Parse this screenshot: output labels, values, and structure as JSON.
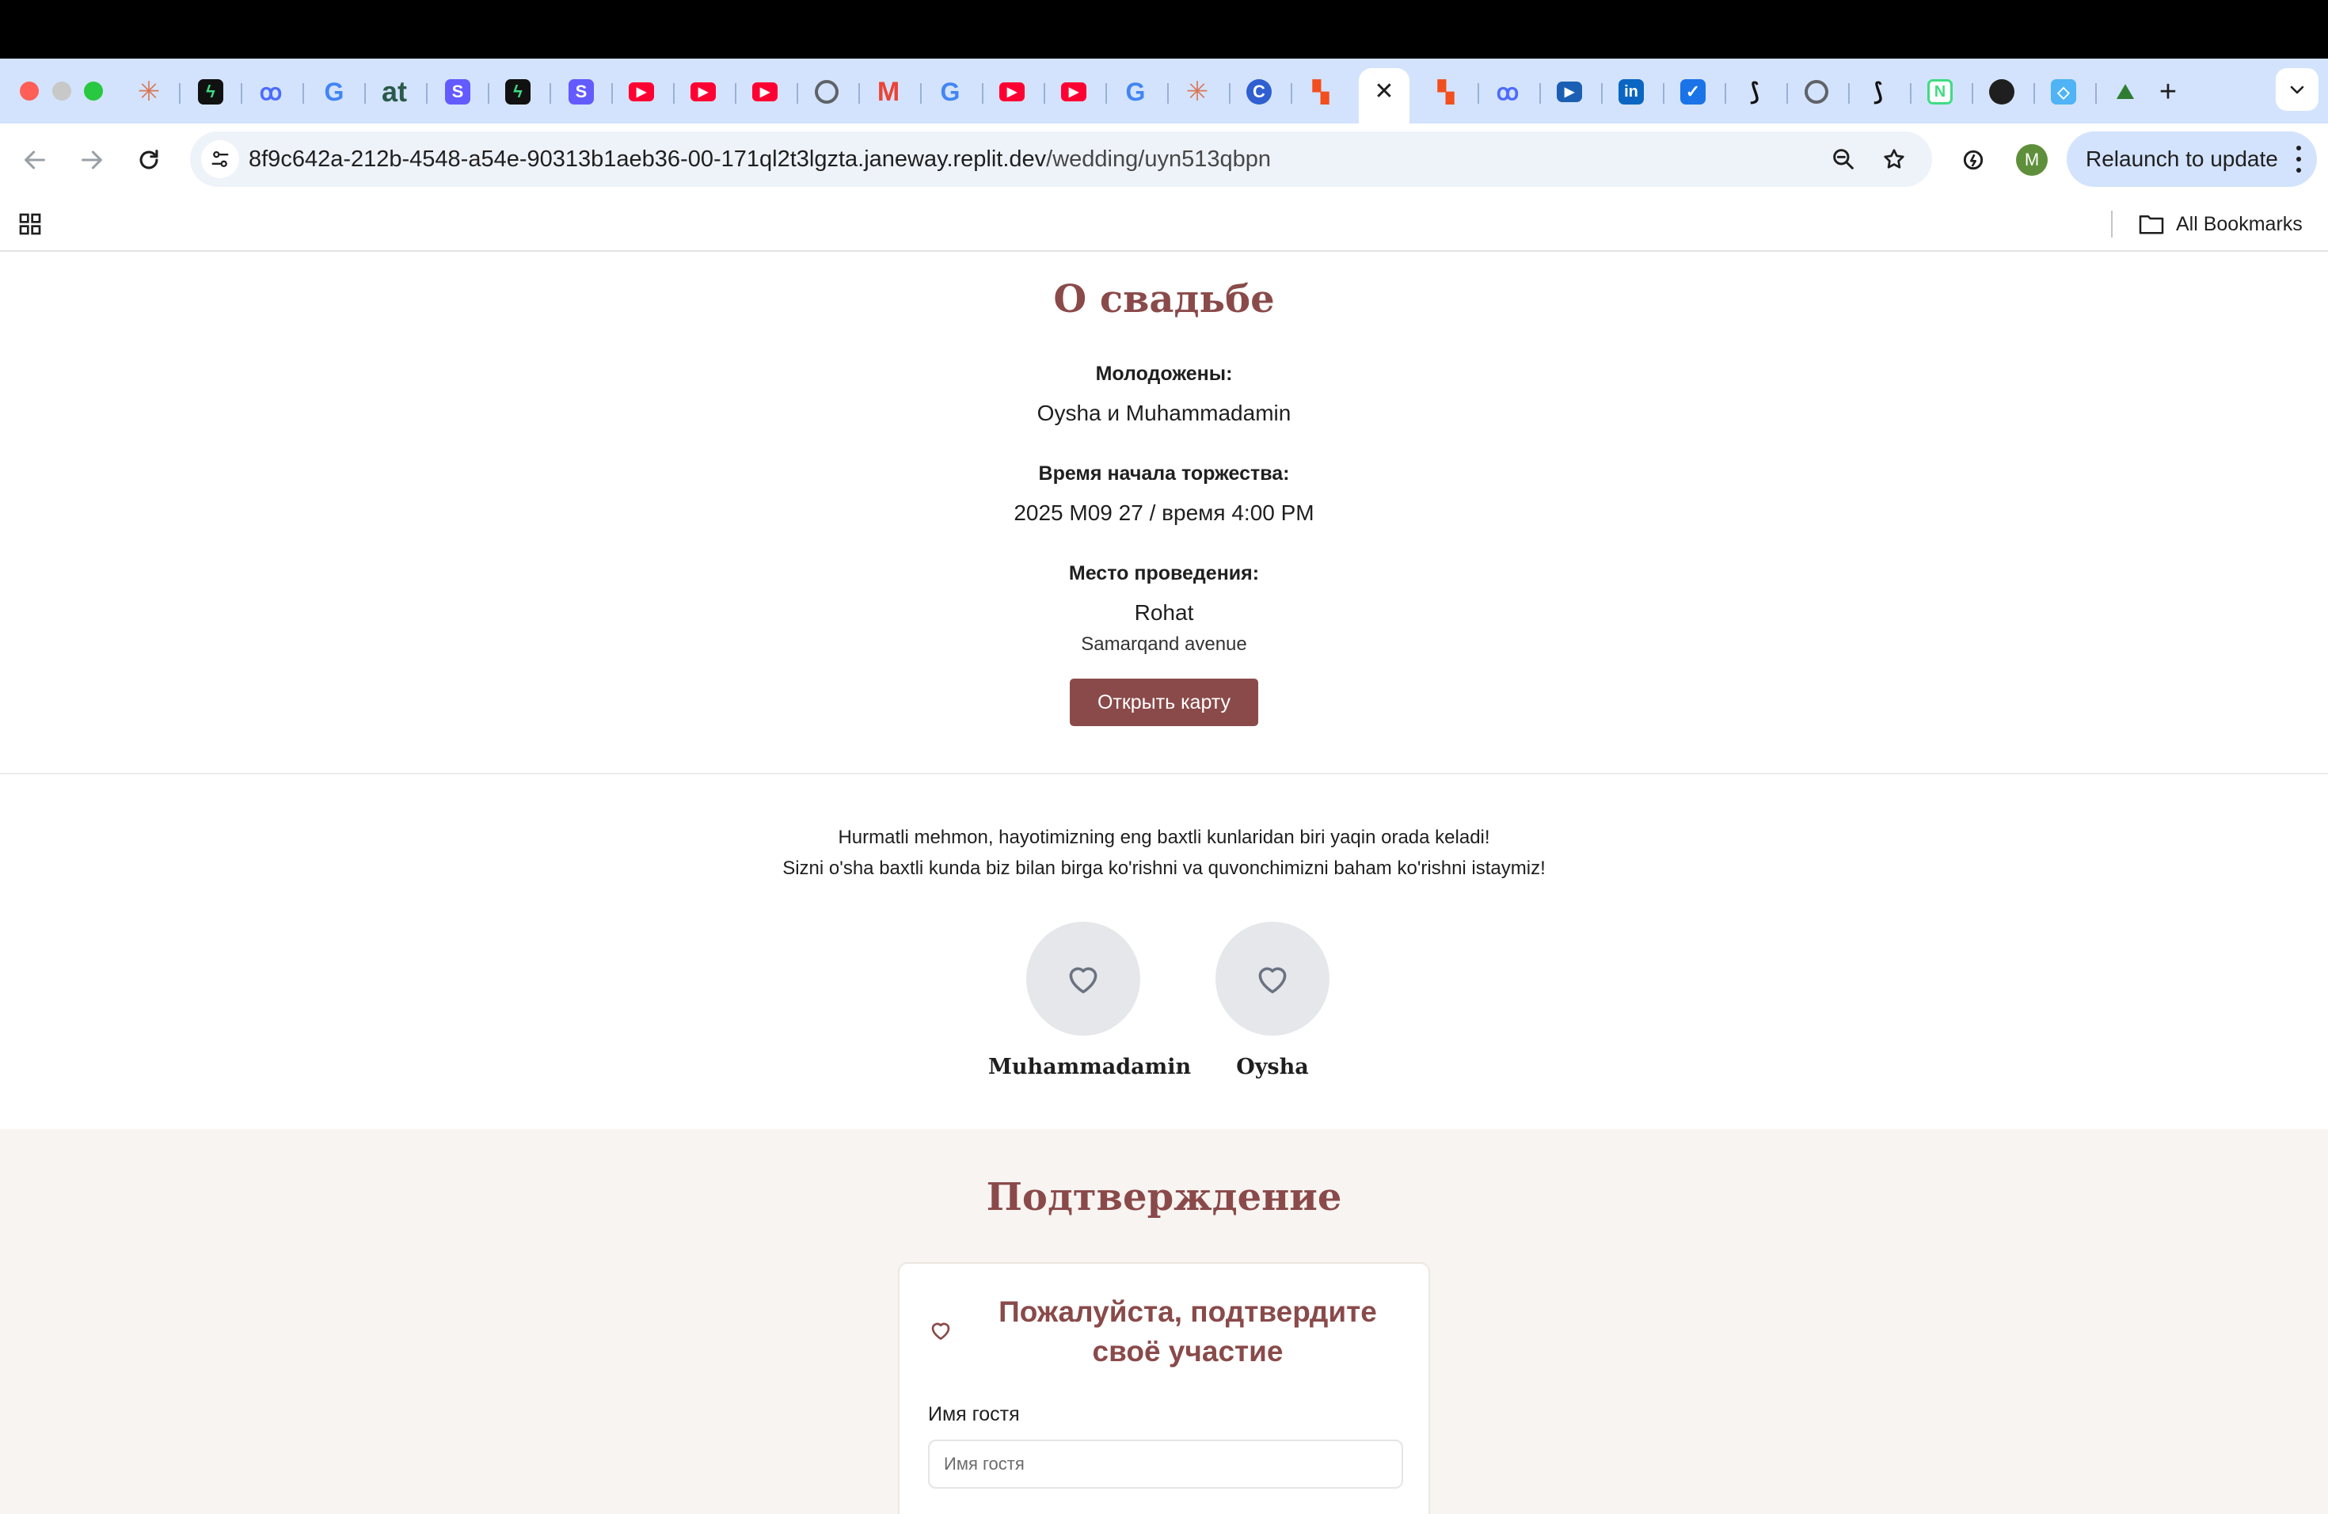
{
  "browser": {
    "url_host": "8f9c642a-212b-4548-a54e-90313b1aeb36-00-171ql2t3lgzta.janeway.replit.dev",
    "url_path": "/wedding/uyn513qbpn",
    "relaunch_label": "Relaunch to update",
    "avatar_letter": "M",
    "bookmarks_label": "All Bookmarks",
    "tab_favicons": [
      "claude-icon",
      "bolt-icon",
      "deepseek-icon",
      "google-icon",
      "at-icon",
      "stripe-icon",
      "bolt-icon",
      "stripe-icon",
      "youtube-icon",
      "youtube-icon",
      "youtube-icon",
      "globe-icon",
      "gmail-icon",
      "google-icon",
      "youtube-icon",
      "youtube-icon",
      "google-icon",
      "claude-icon",
      "c-icon",
      "figma-icon",
      "active-close",
      "figma-icon",
      "deepseek-icon",
      "video-icon",
      "linkedin-icon",
      "tasks-icon",
      "zapier-icon",
      "globe-icon",
      "zapier-icon",
      "notion-icon",
      "github-icon",
      "diamond-icon",
      "landscape-icon"
    ]
  },
  "about": {
    "title": "О свадьбе",
    "couple_label": "Молодожены:",
    "couple_value": "Oysha и Muhammadamin",
    "time_label": "Время начала торжества:",
    "time_value": "2025 M09 27 / время 4:00 PM",
    "venue_label": "Место проведения:",
    "venue_name": "Rohat",
    "venue_address": "Samarqand avenue",
    "map_button": "Открыть карту"
  },
  "greeting": {
    "line1": "Hurmatli mehmon, hayotimizning eng baxtli kunlaridan biri yaqin orada keladi!",
    "line2": "Sizni o'sha baxtli kunda biz bilan birga ko'rishni va quvonchimizni baham ko'rishni istaymiz!",
    "groom": "Muhammadamin",
    "bride": "Oysha"
  },
  "rsvp": {
    "title": "Подтверждение",
    "card_title": "Пожалуйста, подтвердите своё участие",
    "name_label": "Имя гостя",
    "name_placeholder": "Имя гостя",
    "name_value": ""
  },
  "colors": {
    "accent": "#8a4a4a",
    "tabstrip": "#d3e3fd",
    "rsvp_bg": "#f8f4f1"
  }
}
